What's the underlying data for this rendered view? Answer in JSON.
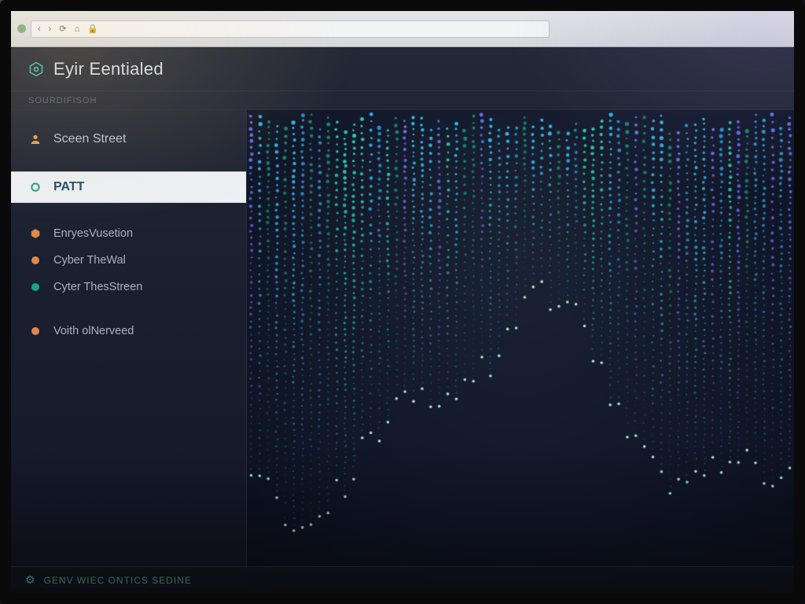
{
  "colors": {
    "accent": "#1aa089",
    "bg": "#1b2030",
    "text": "#cdd3df",
    "orange": "#e0874a"
  },
  "browser": {
    "glyphs": [
      "‹",
      "›",
      "⟳",
      "⌂",
      "🔒"
    ]
  },
  "header": {
    "title": "Eyir Eentialed"
  },
  "subheader": {
    "label": "SOURDIFISOH"
  },
  "sidebar": {
    "items": [
      {
        "id": "screen-street",
        "label": "Sceen Street",
        "icon": "user-icon"
      },
      {
        "id": "patt",
        "label": "PATT",
        "icon": "ring-icon",
        "active": true
      },
      {
        "id": "enryes-vusetion",
        "label": "EnryesVusetion",
        "icon": "hex-icon"
      },
      {
        "id": "cyber-thewal",
        "label": "Cyber TheWal",
        "icon": "dot-orange-icon"
      },
      {
        "id": "cyter-thes-streen",
        "label": "Cyter ThesStreen",
        "icon": "dot-teal-icon"
      },
      {
        "id": "voith-olnerveed",
        "label": "Voith olNerveed",
        "icon": "dot-orange-icon"
      }
    ]
  },
  "footer": {
    "text": "GENV WIEC ONTICS SEDINE"
  },
  "rain": {
    "columns": 64,
    "palette": [
      "#2fe0b7",
      "#32c8ff",
      "#6f7bff",
      "#2aa0d8",
      "#1d8f7a"
    ],
    "min_len": 18,
    "max_len": 42
  }
}
